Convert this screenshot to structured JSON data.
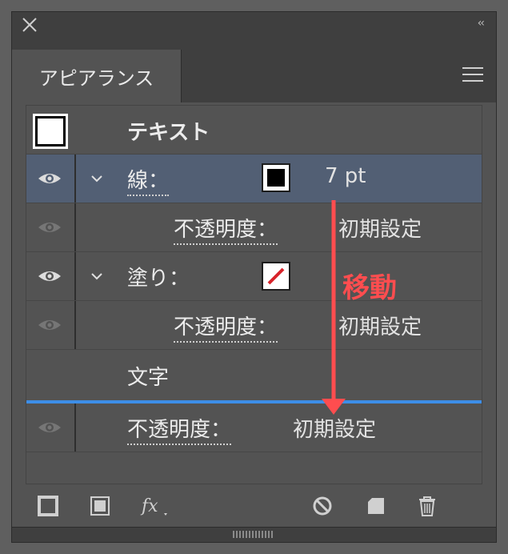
{
  "window": {
    "collapse_label": "‹‹"
  },
  "tab": {
    "label": "アピアランス"
  },
  "header_row": {
    "label": "テキスト"
  },
  "rows": [
    {
      "label": "線：",
      "value": "7 pt",
      "swatch": "black-fill"
    },
    {
      "label": "不透明度：",
      "value": "初期設定"
    },
    {
      "label": "塗り：",
      "swatch": "none-red-slash"
    },
    {
      "label": "不透明度：",
      "value": "初期設定"
    },
    {
      "label": "文字"
    },
    {
      "label": "不透明度：",
      "value": "初期設定"
    }
  ],
  "annotation": {
    "text": "移動",
    "color": "#ff4d4f"
  },
  "colors": {
    "panel_bg": "#535353",
    "selected_row": "#525f74",
    "drop_line": "#3d8ee8"
  },
  "toolbar_icons": [
    "add-stroke-icon",
    "add-fill-icon",
    "fx-icon",
    "clear-icon",
    "duplicate-icon",
    "delete-icon"
  ]
}
